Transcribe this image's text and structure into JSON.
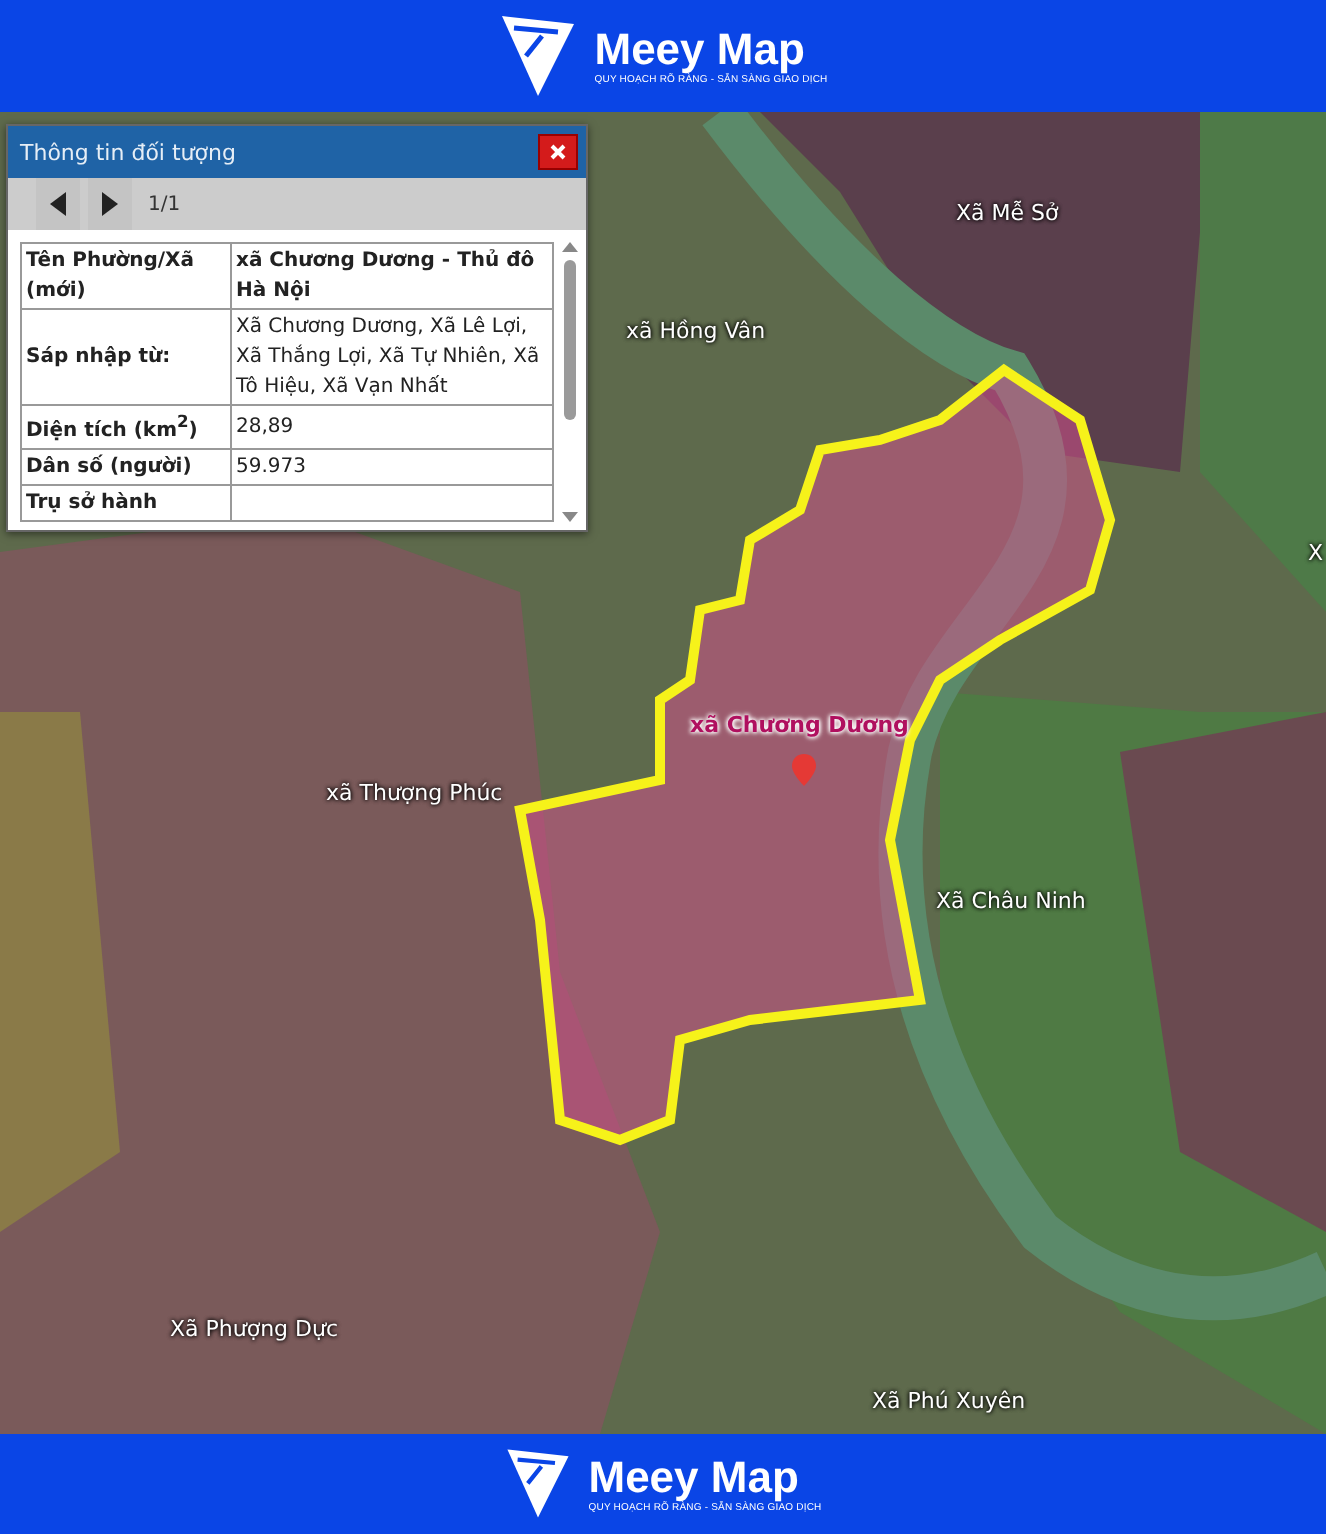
{
  "header": {
    "brand": "Meey Map",
    "tagline": "QUY HOẠCH RÕ RÀNG - SẴN SÀNG GIAO DỊCH"
  },
  "info_panel": {
    "title": "Thông tin đối tượng",
    "page": "1/1",
    "rows": [
      {
        "label": "Tên Phường/Xã (mới)",
        "value": "xã Chương Dương - Thủ đô Hà Nội",
        "highlighted": true
      },
      {
        "label": "Sáp nhập từ:",
        "value": "Xã Chương Dương, Xã Lê Lợi, Xã Thắng Lợi, Xã Tự Nhiên, Xã Tô Hiệu, Xã Vạn Nhất",
        "highlighted": false
      },
      {
        "label": "Diện tích (km$^{2}$)",
        "value": "28,89",
        "highlighted": false
      },
      {
        "label": "Dân số (người)",
        "value": "59.973",
        "highlighted": false
      },
      {
        "label": "Trụ sở hành"
      }
    ]
  },
  "map": {
    "labels": [
      {
        "text": "Xã Mễ Sở",
        "kind": "commune"
      },
      {
        "text": "xã Hồng Vân",
        "kind": "commune"
      },
      {
        "text": "xã Chương Dương",
        "kind": "selected"
      },
      {
        "text": "xã Thượng Phúc",
        "kind": "commune"
      },
      {
        "text": "Xã Châu Ninh",
        "kind": "commune"
      },
      {
        "text": "Xã Phượng Dực",
        "kind": "commune"
      },
      {
        "text": "Xã Phú Xuyên",
        "kind": "commune"
      },
      {
        "text": "X",
        "kind": "commune"
      }
    ]
  },
  "footer": {
    "brand": "Meey Map",
    "tagline": "QUY HOẠCH RÕ RÀNG - SẴN SÀNG GIAO DỊCH"
  }
}
